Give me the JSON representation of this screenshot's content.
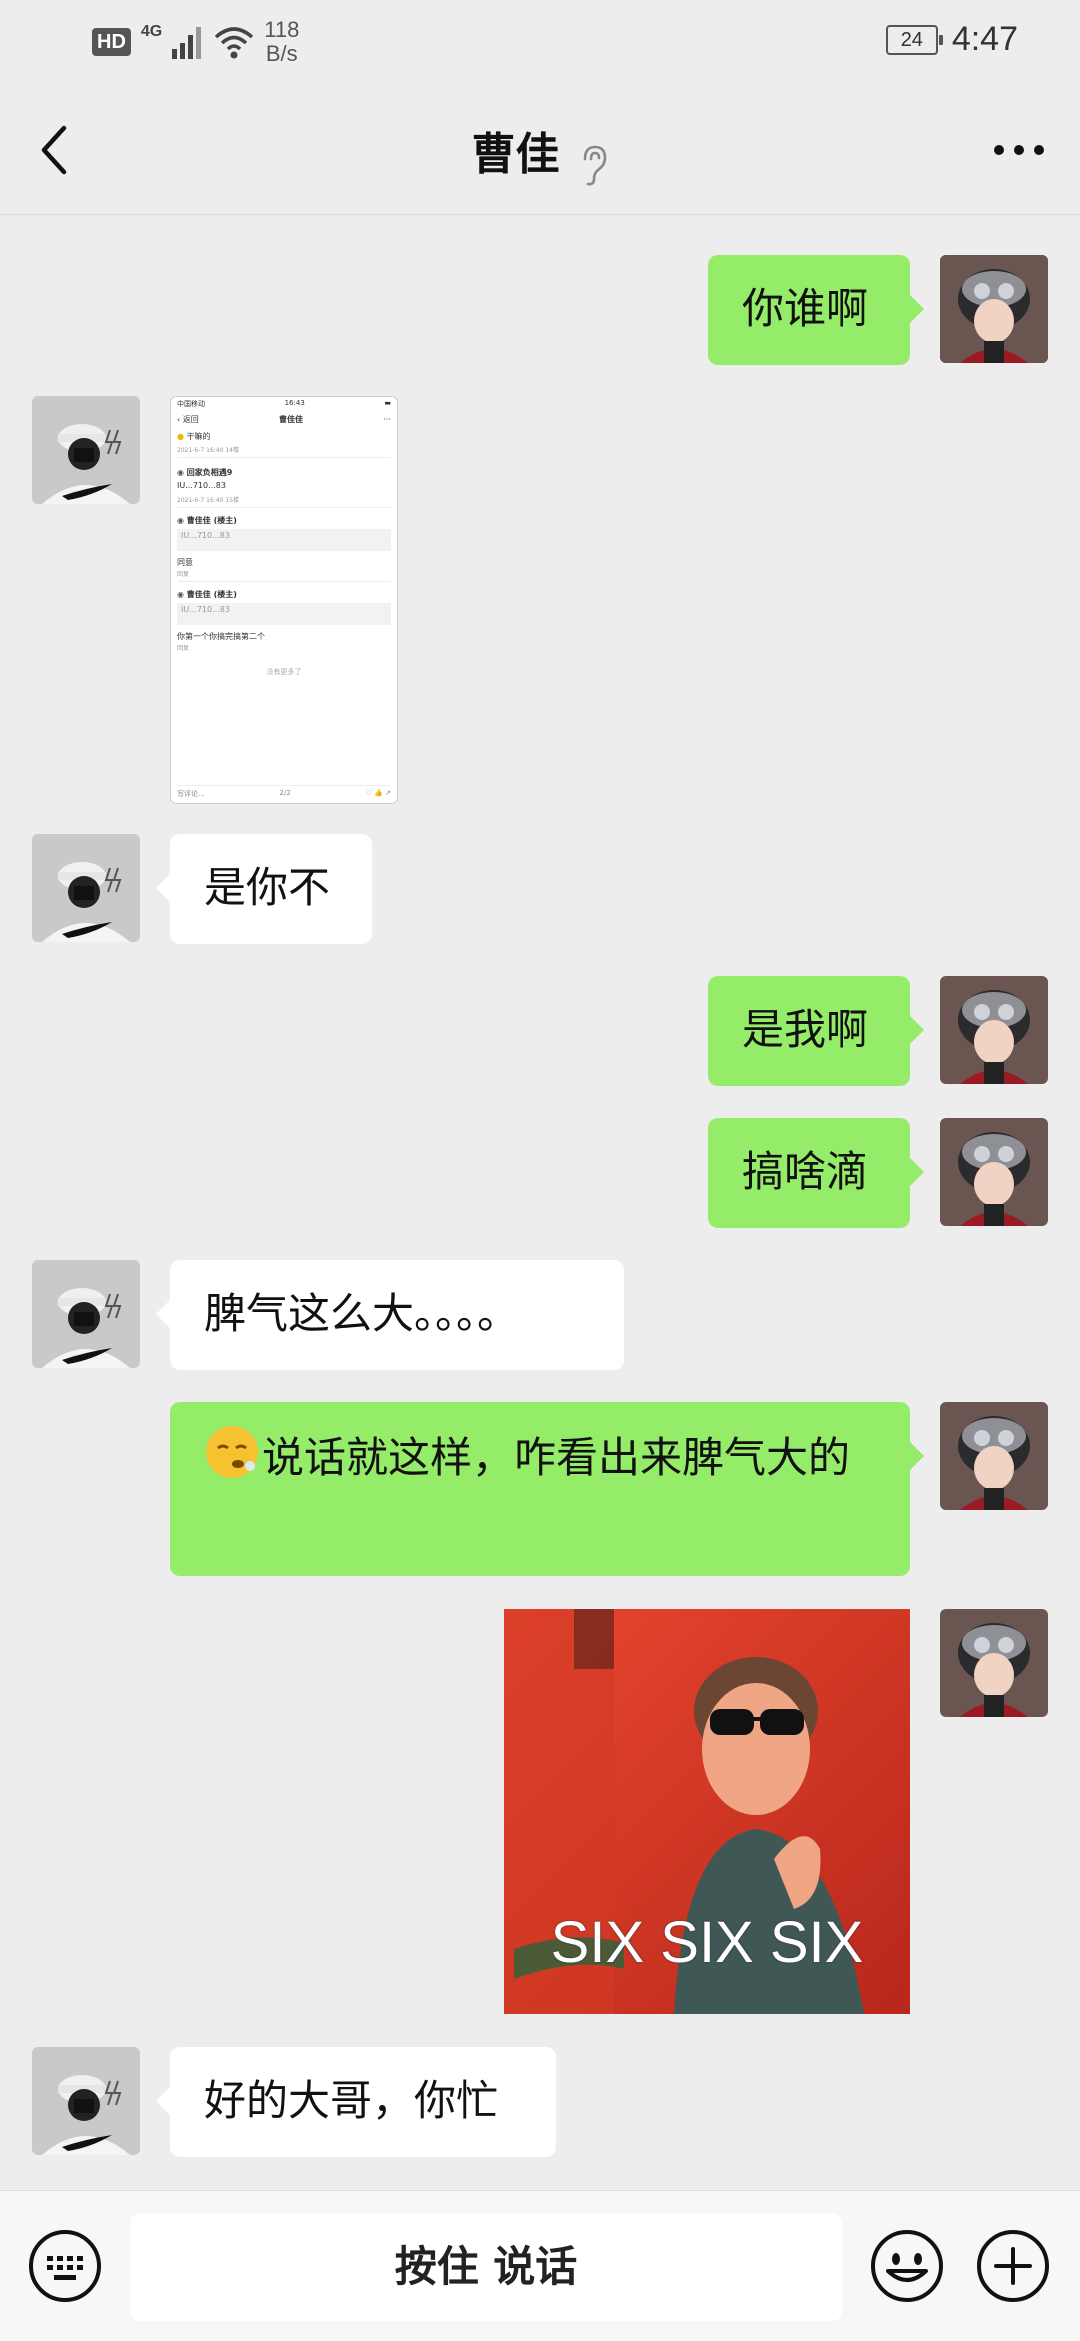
{
  "status_bar": {
    "hd": "HD",
    "network": "4G",
    "speed_value": "118",
    "speed_unit": "B/s",
    "battery": "24",
    "time": "4:47"
  },
  "header": {
    "title": "曹佳"
  },
  "messages": [
    {
      "from": "me",
      "text": "你谁啊"
    },
    {
      "from": "other",
      "type": "image",
      "content": "screenshot"
    },
    {
      "from": "other",
      "text": "是你不"
    },
    {
      "from": "me",
      "text": "是我啊"
    },
    {
      "from": "me",
      "text": "搞啥滴"
    },
    {
      "from": "other",
      "text": "脾气这么大。。。。"
    },
    {
      "from": "me",
      "text": "说话就这样，咋看出来脾气大的",
      "emoji": "😮‍💨"
    },
    {
      "from": "me",
      "type": "image",
      "caption": "SIX SIX SIX"
    },
    {
      "from": "other",
      "text": "好的大哥，你忙"
    }
  ],
  "screenshot": {
    "status_carrier": "中国移动",
    "status_time": "16:43",
    "back_label": "返回",
    "title": "曹佳佳",
    "top_comment": "干嘛的",
    "top_meta": "2021-6-7 16:40 14楼",
    "c1_name": "回家负相遇9",
    "c1_text": "IU...710...83",
    "c1_meta": "2021-6-7 16:40 15楼",
    "c2_name": "曹佳佳 (楼主)",
    "c2_quote": "IU...710...83",
    "c2_text": "同意",
    "c3_name": "曹佳佳 (楼主)",
    "c3_quote": "IU...710...83",
    "c3_text": "你第一个你搞完搞第二个",
    "reply": "回复",
    "no_more": "没有更多了",
    "input_placeholder": "写评论...",
    "page": "2/2"
  },
  "input_bar": {
    "hold_to_talk": "按住 说话"
  },
  "colors": {
    "bubble_me": "#95ec69",
    "bubble_other": "#ffffff",
    "background": "#ededed"
  }
}
